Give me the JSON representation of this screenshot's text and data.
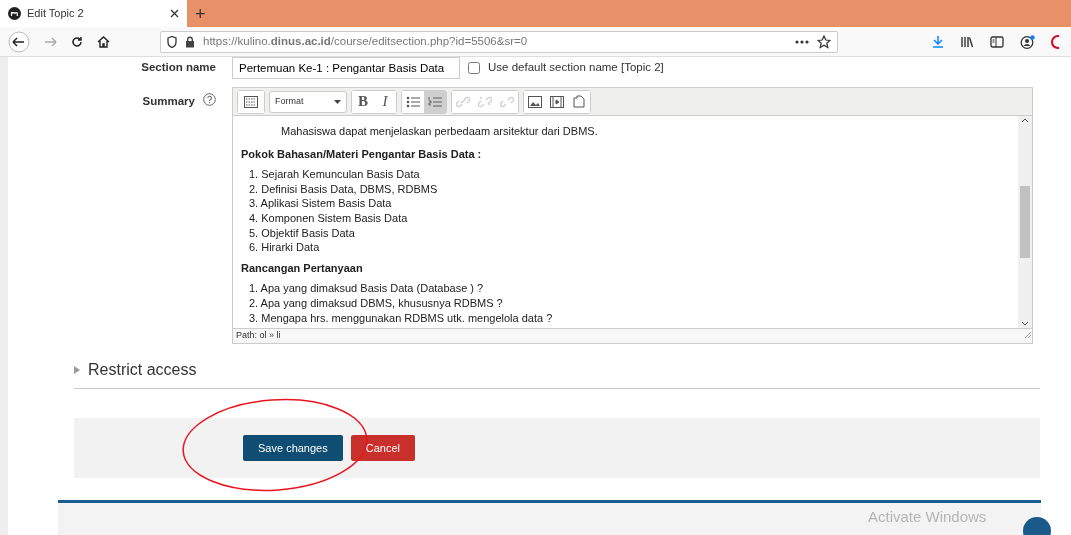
{
  "browser": {
    "tab_title": "Edit Topic 2",
    "new_tab": "+",
    "url": "https://kulino.**dinus.ac.id**/course/editsection.php?id=5506&sr=0"
  },
  "form": {
    "section_name": {
      "label": "Section name",
      "value": "Pertemuan Ke-1 : Pengantar Basis Data",
      "checkbox": {
        "label": "Use default section name [Topic 2]",
        "checked": false
      }
    },
    "summary": {
      "label": "Summary",
      "toolbar": [
        {
          "kind": "kitchen",
          "disabled": false,
          "selected": false
        },
        {
          "kind": "select",
          "label": "Format",
          "disabled": false,
          "selected": false
        },
        {
          "kind": "bold",
          "label": "B",
          "disabled": false,
          "selected": false
        },
        {
          "kind": "italic",
          "label": "I",
          "disabled": false,
          "selected": false
        },
        {
          "kind": "bullets",
          "disabled": false,
          "selected": false
        },
        {
          "kind": "numbers",
          "disabled": false,
          "selected": true
        },
        {
          "kind": "link",
          "disabled": true,
          "selected": false
        },
        {
          "kind": "unlink",
          "disabled": true,
          "selected": false
        },
        {
          "kind": "anchor",
          "disabled": true,
          "selected": false
        },
        {
          "kind": "image",
          "disabled": false,
          "selected": false
        },
        {
          "kind": "media",
          "disabled": false,
          "selected": false
        },
        {
          "kind": "file",
          "disabled": false,
          "selected": false
        }
      ],
      "content": [
        {
          "kind": "para",
          "text": "Mahasiswa dapat menjelaskan perbedaam arsitektur dari DBMS."
        },
        {
          "kind": "heading",
          "text": "Pokok Bahasan/Materi Pengantar Basis Data :"
        },
        {
          "kind": "list",
          "items": [
            "1. Sejarah Kemunculan Basis Data",
            "2. Definisi Basis Data, DBMS, RDBMS",
            "3. Aplikasi Sistem Basis Data",
            "4. Komponen Sistem Basis Data",
            "5. Objektif Basis Data",
            "6. Hirarki Data"
          ]
        },
        {
          "kind": "heading",
          "text": "Rancangan  Pertanyaan"
        },
        {
          "kind": "list",
          "items": [
            "1. Apa yang dimaksud Basis Data (Database ) ?",
            "2. Apa yang dimaksud DBMS, khususnya RDBMS ?",
            "3. Mengapa hrs. menggunakan RDBMS utk. mengelola data ?"
          ]
        }
      ],
      "path": "Path: ol » li"
    },
    "restrict_access": {
      "label": "Restrict access",
      "expanded": false
    },
    "buttons": [
      {
        "kind": "primary",
        "label": "Save changes"
      },
      {
        "kind": "danger",
        "label": "Cancel"
      }
    ]
  },
  "notice": "Activate Windows"
}
